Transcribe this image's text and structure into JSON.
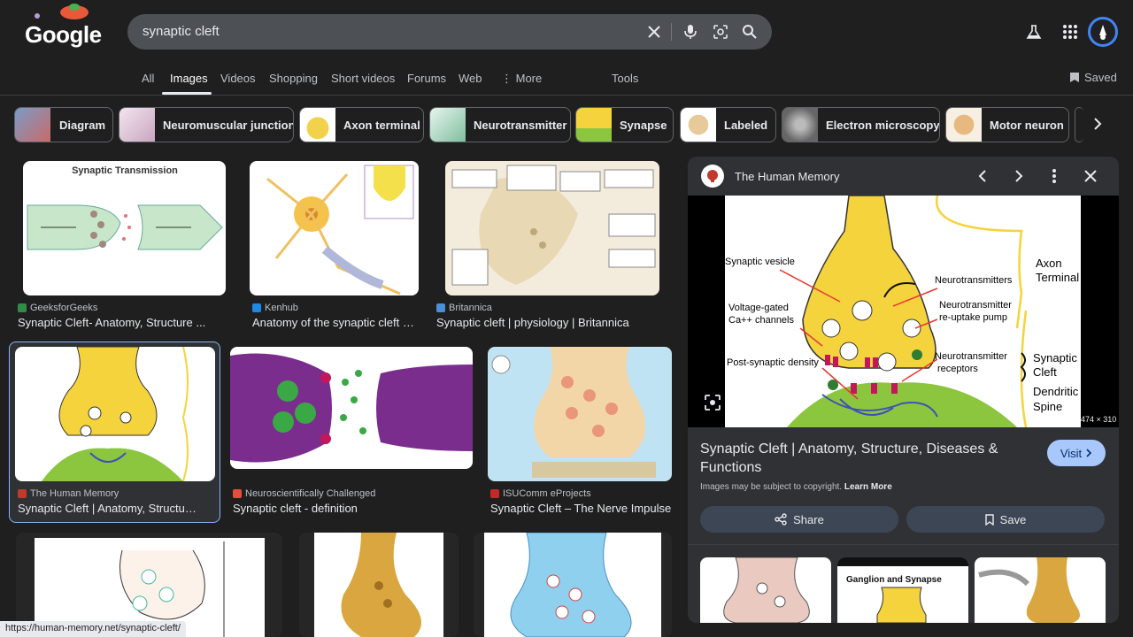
{
  "header": {
    "logo_text": "Google",
    "search_value": "synaptic cleft",
    "icons": [
      "close-icon",
      "mic-icon",
      "lens-icon",
      "search-icon",
      "labs-icon",
      "apps-icon",
      "account-avatar"
    ]
  },
  "tabs": [
    {
      "label": "All"
    },
    {
      "label": "Images",
      "active": true
    },
    {
      "label": "Videos"
    },
    {
      "label": "Shopping"
    },
    {
      "label": "Short videos"
    },
    {
      "label": "Forums"
    },
    {
      "label": "Web"
    },
    {
      "label": "More"
    },
    {
      "label": "Tools"
    }
  ],
  "saved_label": "Saved",
  "chips": [
    {
      "label": "Diagram"
    },
    {
      "label": "Neuromuscular junction"
    },
    {
      "label": "Axon terminal"
    },
    {
      "label": "Neurotransmitter"
    },
    {
      "label": "Synapse"
    },
    {
      "label": "Labeled"
    },
    {
      "label": "Electron microscopy"
    },
    {
      "label": "Motor neuron"
    }
  ],
  "results": [
    {
      "source": "GeeksforGeeks",
      "title": "Synaptic Cleft- Anatomy, Structure ...",
      "img_title": "Synaptic Transmission"
    },
    {
      "source": "Kenhub",
      "title": "Anatomy of the synaptic cleft | K..."
    },
    {
      "source": "Britannica",
      "title": "Synaptic cleft | physiology | Britannica"
    },
    {
      "source": "The Human Memory",
      "title": "Synaptic Cleft | Anatomy, Structure ..."
    },
    {
      "source": "Neuroscientifically Challenged",
      "title": "Synaptic cleft - definition"
    },
    {
      "source": "ISUComm eProjects",
      "title": "Synaptic Cleft – The Nerve Impulse"
    }
  ],
  "panel": {
    "site": "The Human Memory",
    "image_dims": "474 × 310",
    "title": "Synaptic Cleft | Anatomy, Structure, Diseases & Functions",
    "visit_label": "Visit",
    "copyright_text": "Images may be subject to copyright.",
    "learn_more": "Learn More",
    "share_label": "Share",
    "save_label": "Save",
    "diagram_labels": {
      "vesicle": "Synaptic vesicle",
      "calcium1": "Voltage-gated",
      "calcium2": "Ca++ channels",
      "density": "Post-synaptic density",
      "nt": "Neurotransmitters",
      "reuptake1": "Neurotransmitter",
      "reuptake2": "re-uptake pump",
      "receptors1": "Neurotransmitter",
      "receptors2": "receptors",
      "axon1": "Axon",
      "axon2": "Terminal",
      "cleft1": "Synaptic",
      "cleft2": "Cleft",
      "spine1": "Dendritic",
      "spine2": "Spine"
    },
    "related_title": "Ganglion and Synapse"
  },
  "status_url": "https://human-memory.net/synaptic-cleft/"
}
